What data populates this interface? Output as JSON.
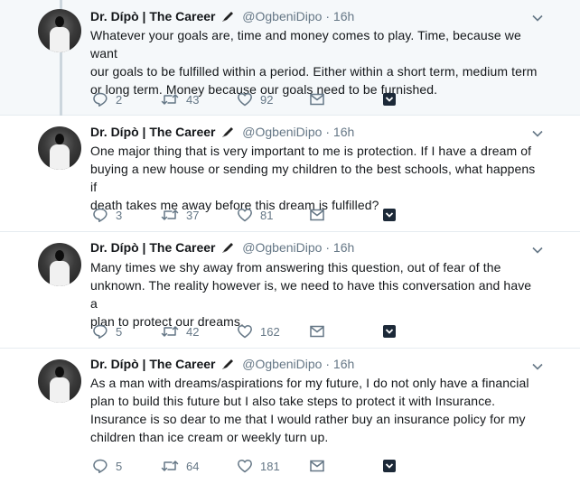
{
  "tweets": [
    {
      "name": "Dr. Dípò | The Career",
      "handle": "@OgbeniDipo",
      "dot": "·",
      "time": "16h",
      "lines": [
        "Whatever your goals are, time and money comes to play. Time, because we want",
        "our goals to be fulfilled within a period. Either within a short term, medium term",
        "or long term. Money because our goals need to be furnished."
      ],
      "replies": "2",
      "retweets": "43",
      "likes": "92"
    },
    {
      "name": "Dr. Dípò | The Career",
      "handle": "@OgbeniDipo",
      "dot": "·",
      "time": "16h",
      "lines": [
        "One major thing that is very important to me is protection. If I have a dream of",
        "buying a new house or sending my children to the best schools, what happens if",
        "death takes me away before this dream is fulfilled?"
      ],
      "replies": "3",
      "retweets": "37",
      "likes": "81"
    },
    {
      "name": "Dr. Dípò | The Career",
      "handle": "@OgbeniDipo",
      "dot": "·",
      "time": "16h",
      "lines": [
        "Many times we shy away from answering this question, out of fear of the",
        "unknown. The reality however is, we need to have this conversation and have a",
        "plan to protect our dreams."
      ],
      "replies": "5",
      "retweets": "42",
      "likes": "162"
    },
    {
      "name": "Dr. Dípò | The Career",
      "handle": "@OgbeniDipo",
      "dot": "·",
      "time": "16h",
      "lines": [
        "As a man with dreams/aspirations for my future, I do not only have a financial",
        "plan to build this future but I also take steps to protect it with Insurance.",
        "Insurance is so dear to me that I would rather buy an insurance policy for my",
        "children than ice cream or weekly turn up."
      ],
      "replies": "5",
      "retweets": "64",
      "likes": "181"
    }
  ],
  "colors": {
    "text": "#14171a",
    "muted": "#657786",
    "highlight_bg": "#f5f8fa",
    "thread_line": "#ccd6dd",
    "bookmark_icon": "#1da1f2"
  },
  "icons": {
    "reply": "reply-icon",
    "retweet": "retweet-icon",
    "like": "heart-icon",
    "dm": "envelope-icon",
    "save": "bookmark-icon",
    "menu": "chevron-down-icon",
    "emoji": "pen-icon"
  }
}
